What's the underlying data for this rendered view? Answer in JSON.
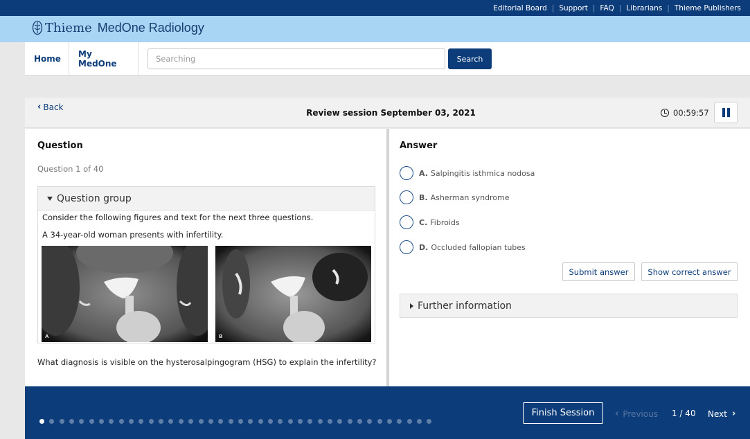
{
  "header": {
    "top_links": [
      "Editorial Board",
      "Support",
      "FAQ",
      "Librarians",
      "Thieme Publishers"
    ],
    "logo_company": "Thieme",
    "logo_product": "MedOne Radiology"
  },
  "nav": {
    "home": "Home",
    "my_medone": "My MedOne",
    "search_placeholder": "Searching",
    "search_button": "Search"
  },
  "session": {
    "back": "Back",
    "title": "Review session September 03, 2021",
    "timer": "00:59:57"
  },
  "question_panel": {
    "heading": "Question",
    "counter": "Question 1 of 40",
    "group_title": "Question group",
    "group_intro": "Consider the following figures and text for the next three questions.",
    "case_text": "A 34-year-old woman presents with infertility.",
    "image_labels": [
      "A",
      "B"
    ],
    "stem": "What diagnosis is visible on the hysterosalpingogram (HSG) to explain the infertility?"
  },
  "answer_panel": {
    "heading": "Answer",
    "options": [
      {
        "letter": "A.",
        "text": "Salpingitis isthmica nodosa"
      },
      {
        "letter": "B.",
        "text": "Asherman syndrome"
      },
      {
        "letter": "C.",
        "text": "Fibroids"
      },
      {
        "letter": "D.",
        "text": "Occluded fallopian tubes"
      }
    ],
    "submit_button": "Submit answer",
    "show_correct_button": "Show correct answer",
    "further_info": "Further information"
  },
  "footer": {
    "finish_button": "Finish Session",
    "previous": "Previous",
    "page": "1 / 40",
    "next": "Next",
    "total_questions": 40,
    "current_question": 1
  },
  "colors": {
    "primary": "#0c3c7a",
    "brand_band": "#a8d5f3"
  }
}
